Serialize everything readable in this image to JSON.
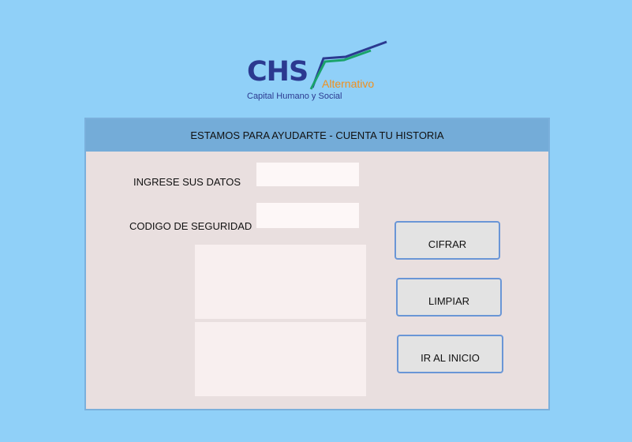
{
  "logo": {
    "brand": "CHS",
    "subbrand": "Alternativo",
    "tagline": "Capital Humano y Social"
  },
  "panel": {
    "title": "ESTAMOS PARA AYUDARTE - CUENTA TU HISTORIA"
  },
  "form": {
    "data_label": "INGRESE SUS DATOS",
    "data_value": "",
    "code_label": "CODIGO DE SEGURIDAD",
    "code_value": "",
    "output_top": "",
    "output_bottom": ""
  },
  "buttons": {
    "encrypt": "CIFRAR",
    "clear": "LIMPIAR",
    "home": "IR AL INICIO"
  },
  "colors": {
    "background": "#90d0f8",
    "panel": "#e9dfdf",
    "header": "#74acd8",
    "button_border": "#6a96d6",
    "brand_blue": "#2b3990",
    "brand_green": "#1aa36a",
    "brand_orange": "#f0901e"
  }
}
